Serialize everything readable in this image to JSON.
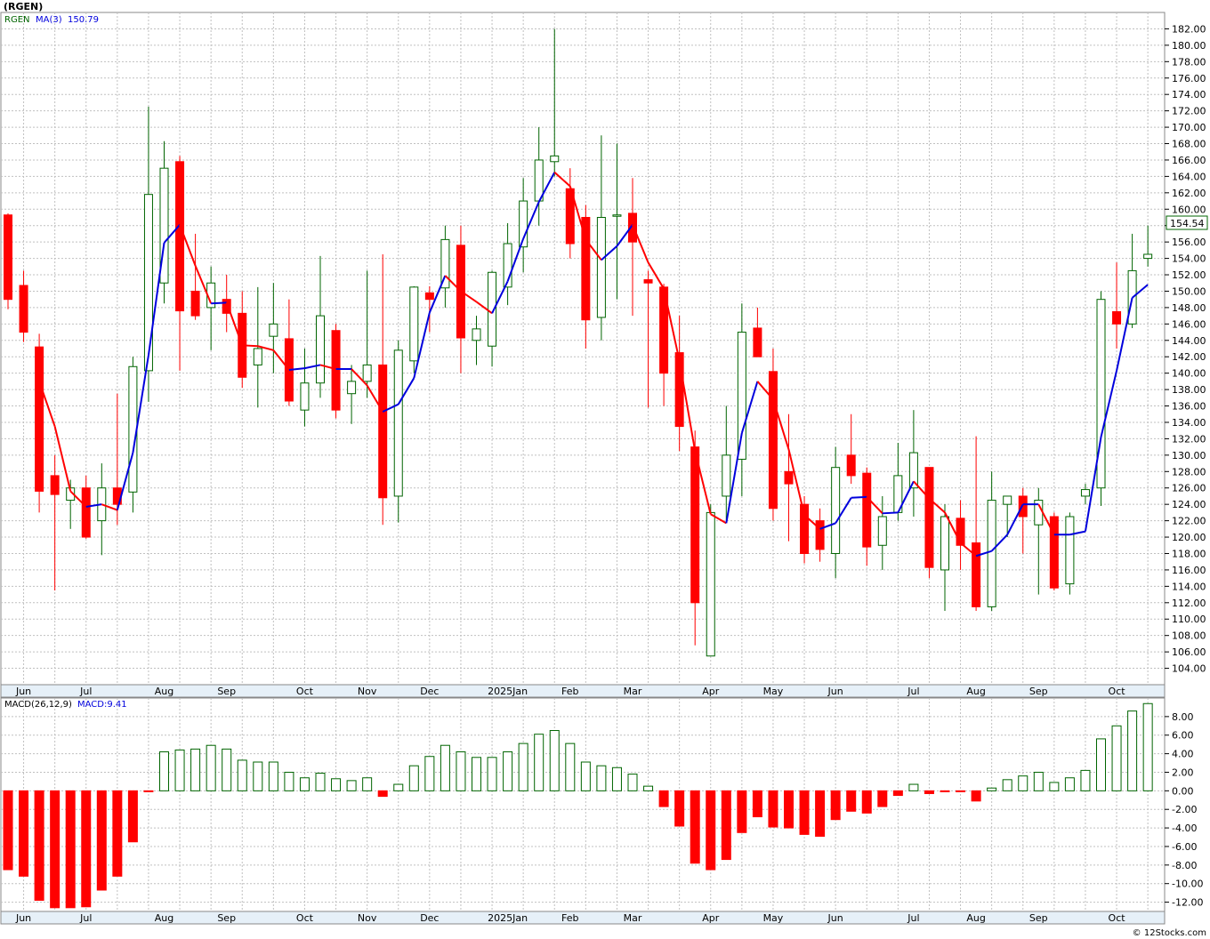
{
  "header": {
    "symbol_label": "(RGEN)"
  },
  "legend": {
    "symbol": "RGEN",
    "ma_label": "MA(3)",
    "ma_value": "150.79"
  },
  "last_price": "154.54",
  "macd_panel": {
    "label": "MACD(26,12,9)",
    "value_label": "MACD:9.41"
  },
  "footer": {
    "watermark": "© 12Stocks.com"
  },
  "colors": {
    "up": "#006400",
    "down": "#ff0000",
    "ma": "#0000dd",
    "macd_up": "#006400",
    "macd_down": "#ff0000",
    "axis_bg": "#e6f0f8"
  },
  "chart_data": [
    {
      "type": "candlestick",
      "series_name": "RGEN",
      "ylim": [
        102,
        184
      ],
      "y_ticks": [
        "104.00",
        "106.00",
        "108.00",
        "110.00",
        "112.00",
        "114.00",
        "116.00",
        "118.00",
        "120.00",
        "122.00",
        "124.00",
        "126.00",
        "128.00",
        "130.00",
        "132.00",
        "134.00",
        "136.00",
        "138.00",
        "140.00",
        "142.00",
        "144.00",
        "146.00",
        "148.00",
        "150.00",
        "152.00",
        "154.00",
        "156.00",
        "158.00",
        "160.00",
        "162.00",
        "164.00",
        "166.00",
        "168.00",
        "170.00",
        "172.00",
        "174.00",
        "176.00",
        "178.00",
        "180.00",
        "182.00"
      ],
      "month_labels": [
        {
          "label": "Jun",
          "week": 1
        },
        {
          "label": "Jul",
          "week": 5
        },
        {
          "label": "Aug",
          "week": 10
        },
        {
          "label": "Sep",
          "week": 14
        },
        {
          "label": "Oct",
          "week": 19
        },
        {
          "label": "Nov",
          "week": 23
        },
        {
          "label": "Dec",
          "week": 27
        },
        {
          "label": "2025Jan",
          "week": 32
        },
        {
          "label": "Feb",
          "week": 36
        },
        {
          "label": "Mar",
          "week": 40
        },
        {
          "label": "Apr",
          "week": 45
        },
        {
          "label": "May",
          "week": 49
        },
        {
          "label": "Jun",
          "week": 53
        },
        {
          "label": "Jul",
          "week": 58
        },
        {
          "label": "Aug",
          "week": 62
        },
        {
          "label": "Sep",
          "week": 66
        },
        {
          "label": "Oct",
          "week": 71
        }
      ],
      "candles": [
        {
          "o": 159.3,
          "h": 159.5,
          "l": 147.8,
          "c": 149.0
        },
        {
          "o": 150.7,
          "h": 152.5,
          "l": 143.8,
          "c": 145.0
        },
        {
          "o": 143.2,
          "h": 144.8,
          "l": 123.0,
          "c": 125.6
        },
        {
          "o": 127.5,
          "h": 130.0,
          "l": 113.5,
          "c": 125.2
        },
        {
          "o": 124.5,
          "h": 127.0,
          "l": 121.0,
          "c": 126.0
        },
        {
          "o": 126.0,
          "h": 127.5,
          "l": 119.8,
          "c": 120.0
        },
        {
          "o": 122.0,
          "h": 129.0,
          "l": 117.8,
          "c": 126.0
        },
        {
          "o": 126.0,
          "h": 137.5,
          "l": 121.5,
          "c": 124.0
        },
        {
          "o": 125.5,
          "h": 142.0,
          "l": 123.0,
          "c": 140.8
        },
        {
          "o": 140.3,
          "h": 172.5,
          "l": 136.5,
          "c": 161.8
        },
        {
          "o": 151.0,
          "h": 168.3,
          "l": 148.5,
          "c": 165.0
        },
        {
          "o": 165.8,
          "h": 166.5,
          "l": 140.3,
          "c": 147.6
        },
        {
          "o": 150.0,
          "h": 157.0,
          "l": 146.5,
          "c": 147.0
        },
        {
          "o": 148.0,
          "h": 153.0,
          "l": 142.8,
          "c": 151.0
        },
        {
          "o": 149.0,
          "h": 152.0,
          "l": 145.0,
          "c": 147.3
        },
        {
          "o": 147.3,
          "h": 150.0,
          "l": 138.2,
          "c": 139.5
        },
        {
          "o": 141.0,
          "h": 150.5,
          "l": 135.8,
          "c": 143.0
        },
        {
          "o": 144.5,
          "h": 151.0,
          "l": 140.0,
          "c": 146.0
        },
        {
          "o": 144.2,
          "h": 149.0,
          "l": 136.0,
          "c": 136.6
        },
        {
          "o": 135.5,
          "h": 143.0,
          "l": 133.5,
          "c": 138.8
        },
        {
          "o": 138.8,
          "h": 154.3,
          "l": 137.0,
          "c": 147.0
        },
        {
          "o": 145.2,
          "h": 146.0,
          "l": 134.5,
          "c": 135.5
        },
        {
          "o": 137.5,
          "h": 141.0,
          "l": 133.8,
          "c": 139.0
        },
        {
          "o": 139.0,
          "h": 152.5,
          "l": 137.0,
          "c": 141.0
        },
        {
          "o": 141.0,
          "h": 154.5,
          "l": 121.5,
          "c": 124.8
        },
        {
          "o": 125.0,
          "h": 144.0,
          "l": 121.8,
          "c": 142.8
        },
        {
          "o": 141.5,
          "h": 150.6,
          "l": 140.0,
          "c": 150.5
        },
        {
          "o": 149.8,
          "h": 150.6,
          "l": 145.0,
          "c": 149.0
        },
        {
          "o": 150.4,
          "h": 158.0,
          "l": 148.0,
          "c": 156.3
        },
        {
          "o": 155.6,
          "h": 158.0,
          "l": 140.0,
          "c": 144.3
        },
        {
          "o": 144.0,
          "h": 147.0,
          "l": 141.0,
          "c": 145.4
        },
        {
          "o": 143.3,
          "h": 152.5,
          "l": 140.8,
          "c": 152.3
        },
        {
          "o": 150.5,
          "h": 158.3,
          "l": 148.3,
          "c": 155.8
        },
        {
          "o": 155.4,
          "h": 163.8,
          "l": 152.3,
          "c": 161.0
        },
        {
          "o": 161.0,
          "h": 170.0,
          "l": 158.0,
          "c": 166.0
        },
        {
          "o": 165.8,
          "h": 182.0,
          "l": 164.0,
          "c": 166.5
        },
        {
          "o": 162.5,
          "h": 165.0,
          "l": 154.0,
          "c": 155.8
        },
        {
          "o": 159.0,
          "h": 160.5,
          "l": 143.0,
          "c": 146.5
        },
        {
          "o": 146.8,
          "h": 169.0,
          "l": 144.0,
          "c": 159.0
        },
        {
          "o": 159.3,
          "h": 168.0,
          "l": 149.0,
          "c": 159.3
        },
        {
          "o": 159.5,
          "h": 163.8,
          "l": 147.0,
          "c": 156.0
        },
        {
          "o": 151.4,
          "h": 152.5,
          "l": 135.8,
          "c": 151.0
        },
        {
          "o": 150.5,
          "h": 150.9,
          "l": 136.0,
          "c": 140.0
        },
        {
          "o": 142.5,
          "h": 147.0,
          "l": 130.5,
          "c": 133.5
        },
        {
          "o": 131.0,
          "h": 133.0,
          "l": 106.8,
          "c": 112.0
        },
        {
          "o": 105.5,
          "h": 124.0,
          "l": 105.5,
          "c": 123.0
        },
        {
          "o": 125.0,
          "h": 136.0,
          "l": 122.0,
          "c": 130.0
        },
        {
          "o": 129.5,
          "h": 148.5,
          "l": 125.0,
          "c": 145.0
        },
        {
          "o": 145.5,
          "h": 148.0,
          "l": 143.0,
          "c": 142.0
        },
        {
          "o": 140.2,
          "h": 143.0,
          "l": 122.0,
          "c": 123.5
        },
        {
          "o": 128.0,
          "h": 135.0,
          "l": 119.5,
          "c": 126.5
        },
        {
          "o": 124.0,
          "h": 125.0,
          "l": 116.8,
          "c": 118.0
        },
        {
          "o": 122.0,
          "h": 123.5,
          "l": 117.0,
          "c": 118.5
        },
        {
          "o": 118.0,
          "h": 131.0,
          "l": 115.0,
          "c": 128.5
        },
        {
          "o": 130.0,
          "h": 135.0,
          "l": 126.5,
          "c": 127.5
        },
        {
          "o": 127.8,
          "h": 128.5,
          "l": 116.5,
          "c": 118.8
        },
        {
          "o": 119.0,
          "h": 125.0,
          "l": 116.0,
          "c": 122.5
        },
        {
          "o": 123.0,
          "h": 131.5,
          "l": 122.0,
          "c": 127.5
        },
        {
          "o": 126.0,
          "h": 135.5,
          "l": 122.5,
          "c": 130.3
        },
        {
          "o": 128.5,
          "h": 128.5,
          "l": 115.0,
          "c": 116.3
        },
        {
          "o": 116.0,
          "h": 124.0,
          "l": 111.0,
          "c": 122.5
        },
        {
          "o": 122.3,
          "h": 124.5,
          "l": 116.0,
          "c": 119.0
        },
        {
          "o": 119.3,
          "h": 132.3,
          "l": 111.0,
          "c": 111.5
        },
        {
          "o": 111.5,
          "h": 128.0,
          "l": 111.0,
          "c": 124.5
        },
        {
          "o": 124.0,
          "h": 125.0,
          "l": 120.0,
          "c": 125.0
        },
        {
          "o": 125.0,
          "h": 126.0,
          "l": 118.0,
          "c": 122.5
        },
        {
          "o": 121.5,
          "h": 126.0,
          "l": 113.0,
          "c": 124.5
        },
        {
          "o": 122.5,
          "h": 123.0,
          "l": 113.5,
          "c": 113.8
        },
        {
          "o": 114.3,
          "h": 123.0,
          "l": 113.0,
          "c": 122.5
        },
        {
          "o": 125.0,
          "h": 126.5,
          "l": 124.0,
          "c": 125.8
        },
        {
          "o": 126.0,
          "h": 150.0,
          "l": 123.8,
          "c": 149.0
        },
        {
          "o": 147.5,
          "h": 153.5,
          "l": 143.0,
          "c": 146.0
        },
        {
          "o": 146.0,
          "h": 157.0,
          "l": 145.5,
          "c": 152.5
        },
        {
          "o": 154.0,
          "h": 158.0,
          "l": 153.0,
          "c": 154.5
        }
      ],
      "ma3": [
        null,
        null,
        139.0,
        133.5,
        125.6,
        123.7,
        124.0,
        123.3,
        130.3,
        142.2,
        155.9,
        158.1,
        153.1,
        148.5,
        148.6,
        143.4,
        143.3,
        142.8,
        140.4,
        140.6,
        141.0,
        140.5,
        140.5,
        138.5,
        135.3,
        136.2,
        139.4,
        147.4,
        151.9,
        150.0,
        148.7,
        147.3,
        151.2,
        156.4,
        160.9,
        164.5,
        162.8,
        156.3,
        153.8,
        155.5,
        158.1,
        153.5,
        150.3,
        141.5,
        130.5,
        122.8,
        121.7,
        132.7,
        139.0,
        136.8,
        130.7,
        122.7,
        121.0,
        121.7,
        124.8,
        124.9,
        122.9,
        123.0,
        126.8,
        124.7,
        123.0,
        119.3,
        117.7,
        118.3,
        120.3,
        124.0,
        124.0,
        120.3,
        120.3,
        120.7,
        132.2,
        140.3,
        149.2,
        150.8
      ]
    },
    {
      "type": "bar",
      "series_name": "MACD(26,12,9)",
      "ylim": [
        -13,
        10
      ],
      "y_ticks": [
        "8.00",
        "6.00",
        "4.00",
        "2.00",
        "0.00",
        "-2.00",
        "-4.00",
        "-6.00",
        "-8.00",
        "-10.00",
        "-12.00"
      ],
      "values": [
        -8.5,
        -9.2,
        -11.8,
        -12.6,
        -12.6,
        -12.5,
        -10.7,
        -9.2,
        -5.5,
        -0.1,
        4.2,
        4.4,
        4.5,
        4.9,
        4.5,
        3.3,
        3.1,
        3.1,
        2.0,
        1.4,
        1.9,
        1.3,
        1.1,
        1.4,
        -0.6,
        0.7,
        2.7,
        3.7,
        4.9,
        4.2,
        3.6,
        3.6,
        4.2,
        5.1,
        6.1,
        6.5,
        5.1,
        3.1,
        2.7,
        2.5,
        1.8,
        0.5,
        -1.7,
        -3.8,
        -7.8,
        -8.5,
        -7.4,
        -4.5,
        -2.8,
        -3.9,
        -4.0,
        -4.7,
        -4.9,
        -3.1,
        -2.2,
        -2.4,
        -1.7,
        -0.5,
        0.7,
        -0.3,
        -0.1,
        -0.1,
        -1.1,
        0.3,
        1.2,
        1.6,
        2.0,
        0.9,
        1.4,
        2.2,
        5.6,
        7.0,
        8.6,
        9.4
      ]
    }
  ]
}
